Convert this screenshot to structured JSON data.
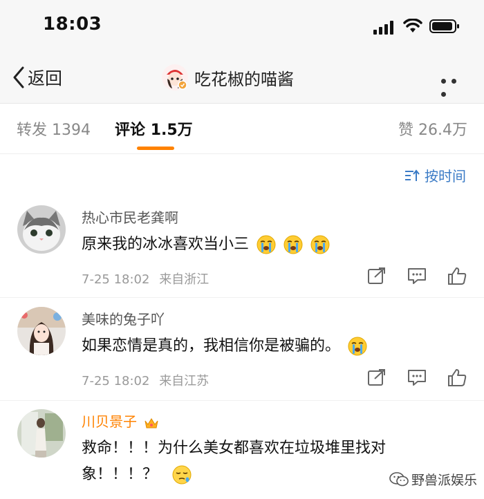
{
  "status_bar": {
    "time": "18:03"
  },
  "nav": {
    "back_label": "返回",
    "title": "吃花椒的喵酱"
  },
  "tabs": {
    "repost_label": "转发",
    "repost_count": "1394",
    "comment_label": "评论",
    "comment_count": "1.5万",
    "like_label": "赞",
    "like_count": "26.4万"
  },
  "sort": {
    "label": "按时间"
  },
  "comments": [
    {
      "username": "热心市民老龚啊",
      "text": "原来我的冰冰喜欢当小三",
      "date": "7-25 18:02",
      "location": "来自浙江"
    },
    {
      "username": "美味的兔子吖",
      "text": "如果恋情是真的，我相信你是被骗的。",
      "date": "7-25 18:02",
      "location": "来自江苏"
    },
    {
      "username": "川贝景子",
      "text_line1": "救命！！！为什么美女都喜欢在垃圾堆里找对",
      "text_line2": "象！！！？"
    }
  ],
  "watermark": {
    "text": "野兽派娱乐"
  },
  "colors": {
    "accent": "#ff8200",
    "link": "#3b7bc6"
  },
  "icons": [
    "signal-icon",
    "wifi-icon",
    "battery-icon",
    "back-arrow-icon",
    "more-icon",
    "sort-icon",
    "share-icon",
    "reply-icon",
    "thumb-up-icon",
    "crying-emoji-icon",
    "sleepy-emoji-icon",
    "crown-badge-icon",
    "wechat-icon"
  ]
}
